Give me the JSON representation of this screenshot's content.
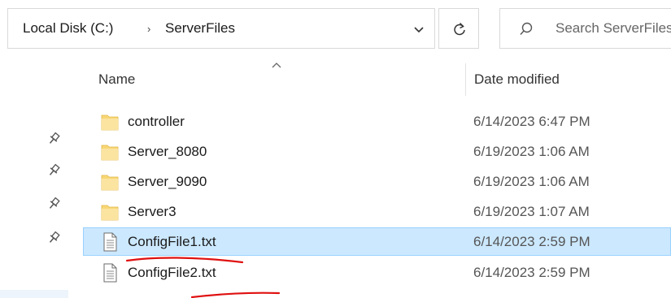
{
  "address_bar": {
    "crumbs": [
      "Local Disk (C:)",
      "ServerFiles"
    ],
    "separator": "›"
  },
  "search": {
    "placeholder": "Search ServerFiles"
  },
  "columns": {
    "name": "Name",
    "date_modified": "Date modified"
  },
  "files": [
    {
      "name": "controller",
      "date": "6/14/2023 6:47 PM",
      "type": "folder"
    },
    {
      "name": "Server_8080",
      "date": "6/19/2023 1:06 AM",
      "type": "folder"
    },
    {
      "name": "Server_9090",
      "date": "6/19/2023 1:06 AM",
      "type": "folder"
    },
    {
      "name": "Server3",
      "date": "6/19/2023 1:07 AM",
      "type": "folder"
    },
    {
      "name": "ConfigFile1.txt",
      "date": "6/14/2023 2:59 PM",
      "type": "text-file",
      "selected": true
    },
    {
      "name": "ConfigFile2.txt",
      "date": "6/14/2023 2:59 PM",
      "type": "text-file"
    }
  ],
  "colors": {
    "selection_fill": "#cce8ff",
    "selection_border": "#99d1ff",
    "folder_yellow": "#f8d775",
    "annotation_red": "#e01010"
  },
  "icons": {
    "refresh": "refresh-icon",
    "search": "search-icon",
    "dropdown": "chevron-down-icon",
    "pin": "pin-icon",
    "folder": "folder-icon",
    "text_file": "text-file-icon"
  }
}
